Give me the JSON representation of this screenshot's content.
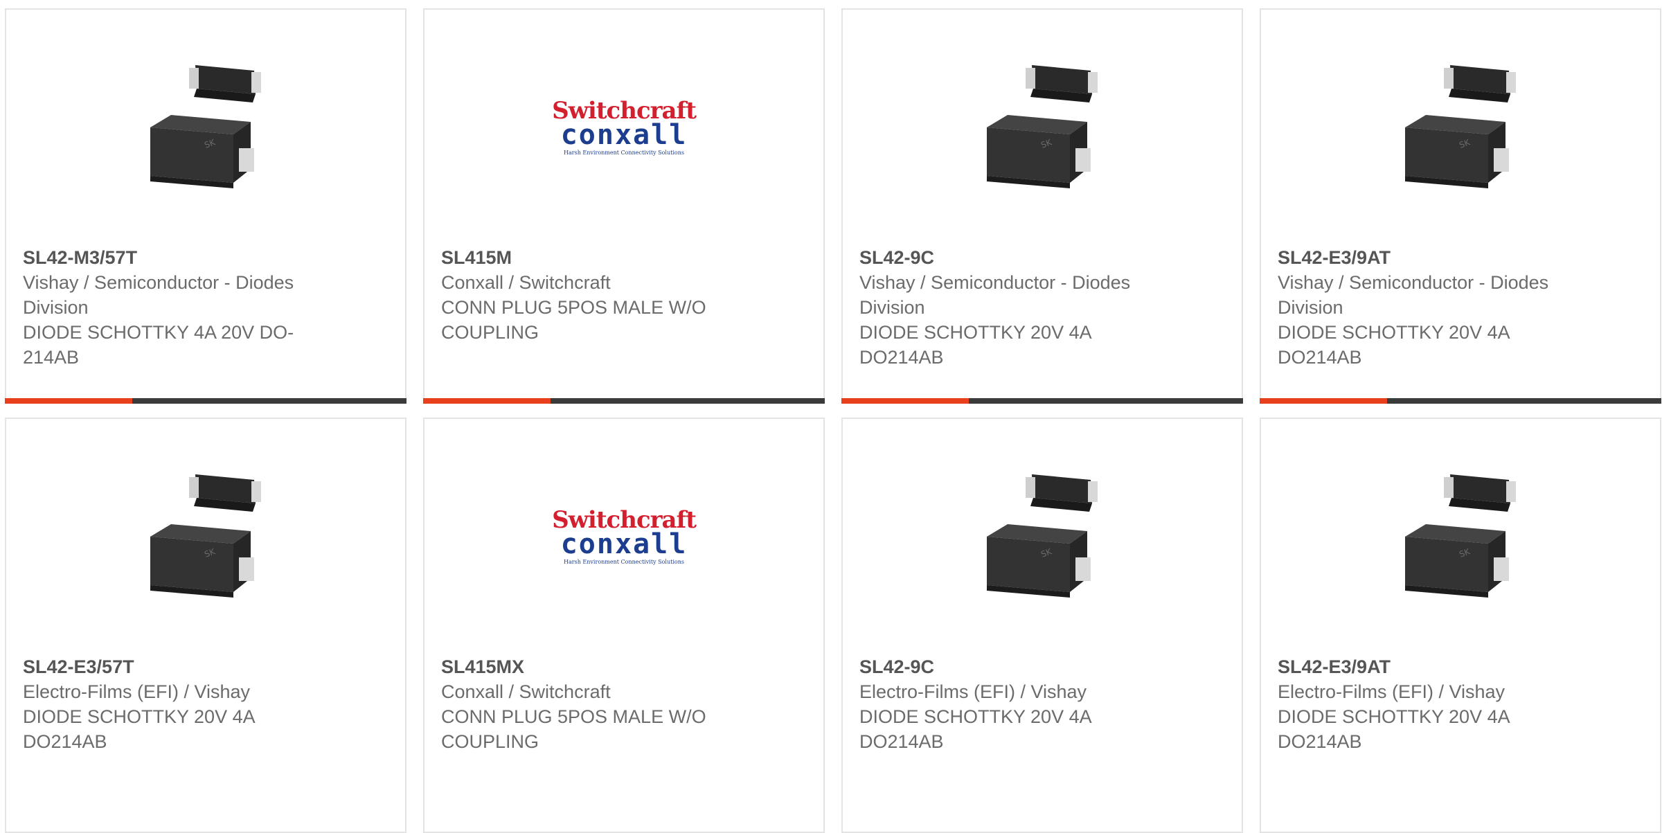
{
  "products": [
    {
      "part_number": "SL42-M3/57T",
      "manufacturer": "Vishay / Semiconductor - Diodes Division",
      "description": "DIODE SCHOTTKY 4A 20V DO-214AB",
      "image": "diode-package-image"
    },
    {
      "part_number": "SL415M",
      "manufacturer": "Conxall / Switchcraft",
      "description": "CONN PLUG 5POS MALE W/O COUPLING",
      "image": "switchcraft-conxall-logo"
    },
    {
      "part_number": "SL42-9C",
      "manufacturer": "Vishay / Semiconductor - Diodes Division",
      "description": "DIODE SCHOTTKY 20V 4A DO214AB",
      "image": "diode-package-image"
    },
    {
      "part_number": "SL42-E3/9AT",
      "manufacturer": "Vishay / Semiconductor - Diodes Division",
      "description": "DIODE SCHOTTKY 20V 4A DO214AB",
      "image": "diode-package-image"
    },
    {
      "part_number": "SL42-E3/57T",
      "manufacturer": "Electro-Films (EFI) / Vishay",
      "description": "DIODE SCHOTTKY 20V 4A DO214AB",
      "image": "diode-package-image"
    },
    {
      "part_number": "SL415MX",
      "manufacturer": "Conxall / Switchcraft",
      "description": "CONN PLUG 5POS MALE W/O COUPLING",
      "image": "switchcraft-conxall-logo"
    },
    {
      "part_number": "SL42-9C",
      "manufacturer": "Electro-Films (EFI) / Vishay",
      "description": "DIODE SCHOTTKY 20V 4A DO214AB",
      "image": "diode-package-image"
    },
    {
      "part_number": "SL42-E3/9AT",
      "manufacturer": "Electro-Films (EFI) / Vishay",
      "description": "DIODE SCHOTTKY 20V 4A DO214AB",
      "image": "diode-package-image"
    }
  ],
  "logo": {
    "line1": "Switchcraft",
    "line2": "conxall",
    "line3": "Harsh Environment Connectivity Solutions"
  },
  "colors": {
    "accent": "#e8401c",
    "bar": "#3b3b3b",
    "border": "#e4e4e4",
    "text": "#6b6b6b"
  }
}
